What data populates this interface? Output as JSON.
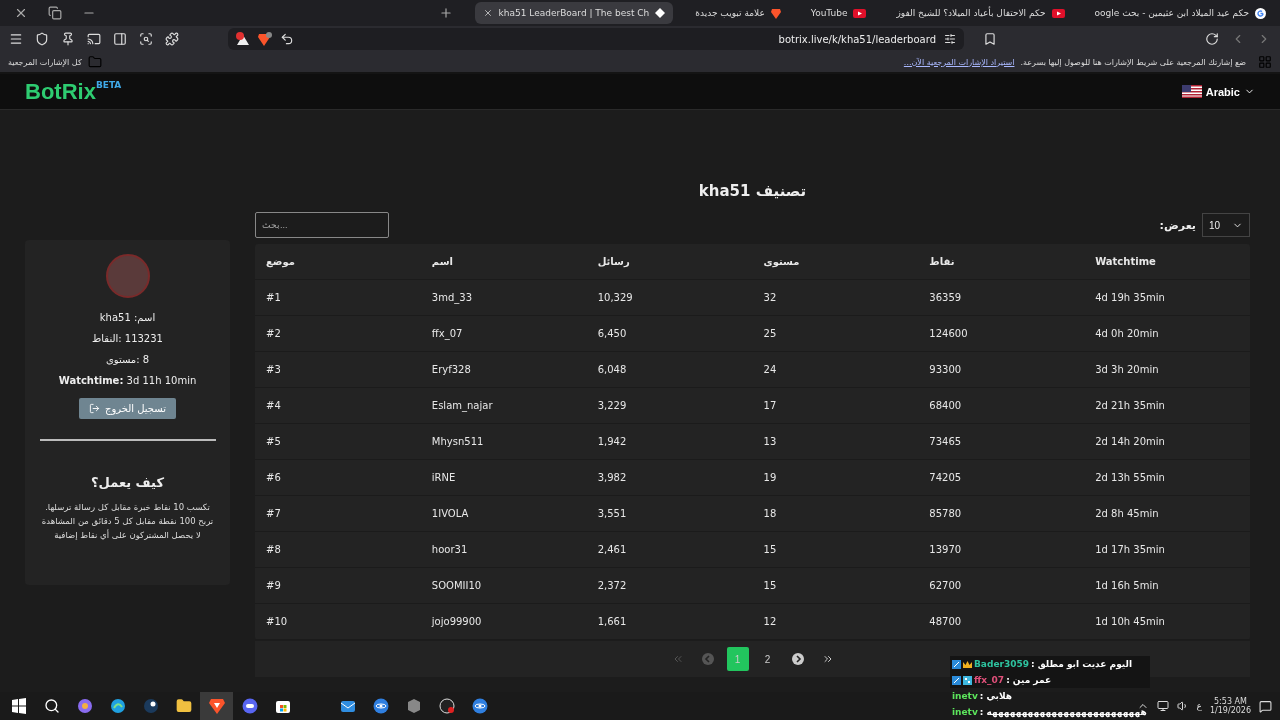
{
  "tabs": [
    {
      "title": "حكم عيد الميلاد ابن عثيمين - بحث oogle",
      "kind": "google",
      "selected": false
    },
    {
      "title": "حكم الاحتفال بأعياد الميلاد؟ للشيخ الفوز",
      "kind": "youtube",
      "selected": false
    },
    {
      "title": "YouTube",
      "kind": "youtube",
      "selected": false
    },
    {
      "title": "علامة تبويب جديدة",
      "kind": "brave",
      "selected": false
    },
    {
      "title": "kha51 LeaderBoard | The best Ch",
      "kind": "page",
      "selected": true
    }
  ],
  "address": {
    "url": "botrix.live/k/kha51/leaderboard"
  },
  "bookmarks_bar": {
    "folder": "كل الإشارات المرجعية",
    "hint": "ضع إشارتك المرجعية على شريط الإشارات هنا للوصول إليها بسرعة.",
    "import_link": "استيراد الإشارات المرجعية الآن..."
  },
  "header": {
    "logo": "BotRix",
    "badge": "BETA",
    "language": "Arabic"
  },
  "profile": {
    "lines": [
      "kha51 :اسم",
      "113231 :النقاط",
      "8 :مستوى",
      "**Watchtime:** 3d 11h 10min"
    ],
    "logout": "تسجيل الخروج",
    "help_title": "كيف يعمل؟",
    "help_lines": [
      "تكسب 10 نقاط خبرة مقابل كل رسالة ترسلها.",
      "تربح 100 نقطة مقابل كل 5 دقائق من المشاهدة",
      "لا يحصل المشتركون على أي نقاط إضافية"
    ]
  },
  "leaderboard": {
    "title": "kha51 تصنيف",
    "search": {
      "placeholder": "بحث..."
    },
    "show_label": "يعرض:",
    "page_size": "10",
    "columns": [
      "Watchtime",
      "نقاط",
      "مستوى",
      "رسائل",
      "اسم",
      "موضع"
    ],
    "rows": [
      [
        "4d 19h 35min",
        "36359",
        "32",
        "10,329",
        "3md_33",
        "#1"
      ],
      [
        "4d 0h 20min",
        "124600",
        "25",
        "6,450",
        "ffx_07",
        "#2"
      ],
      [
        "3d 3h 20min",
        "93300",
        "24",
        "6,048",
        "Eryf328",
        "#3"
      ],
      [
        "2d 21h 35min",
        "68400",
        "17",
        "3,229",
        "Eslam_najar",
        "#4"
      ],
      [
        "2d 14h 20min",
        "73465",
        "13",
        "1,942",
        "Mhysn511",
        "#5"
      ],
      [
        "2d 13h 55min",
        "74205",
        "19",
        "3,982",
        "iRNE",
        "#6"
      ],
      [
        "2d 8h 45min",
        "85780",
        "18",
        "3,551",
        "1IVOLA",
        "#7"
      ],
      [
        "1d 17h 35min",
        "13970",
        "15",
        "2,461",
        "hoor31",
        "#8"
      ],
      [
        "1d 16h 5min",
        "62700",
        "15",
        "2,372",
        "SOOMII10",
        "#9"
      ],
      [
        "1d 10h 45min",
        "48700",
        "12",
        "1,661",
        "jojo99900",
        "#10"
      ]
    ],
    "pagination": {
      "first_disabled": true,
      "prev_disabled": true,
      "pages": [
        {
          "label": "2",
          "selected": false
        },
        {
          "label": "1",
          "selected": true
        }
      ]
    }
  },
  "chat": [
    {
      "user": "Bader3059",
      "color": "#2ec4a0",
      "text": ": اليوم عديت ابو مطلق",
      "kind": "crown"
    },
    {
      "user": "ffx_07",
      "color": "#e0507a",
      "text": ": عمر مين",
      "kind": "sub"
    },
    {
      "user": "inetv",
      "color": "#5ce65c",
      "text": ": هلابي",
      "kind": "plain"
    },
    {
      "user": "inetv",
      "color": "#5ce65c",
      "text": ": ههههههههههههههههههههههههههه",
      "kind": "plain"
    }
  ],
  "taskbar": {
    "pinned": [
      {
        "kind": "windows",
        "active": false
      },
      {
        "kind": "search",
        "active": false
      },
      {
        "kind": "copilot",
        "active": false
      },
      {
        "kind": "edge",
        "active": false
      },
      {
        "kind": "steam",
        "active": false
      },
      {
        "kind": "folder",
        "active": false
      },
      {
        "kind": "brave",
        "active": true
      },
      {
        "kind": "discord",
        "active": false
      },
      {
        "kind": "store",
        "active": false
      }
    ],
    "running": [
      {
        "kind": "mail",
        "active": false
      },
      {
        "kind": "atom",
        "active": false
      },
      {
        "kind": "cube",
        "active": false
      },
      {
        "kind": "obs",
        "active": false
      },
      {
        "kind": "atom",
        "active": false
      }
    ],
    "language": "ع",
    "time": "5:53 AM",
    "date": "1/19/2026"
  }
}
